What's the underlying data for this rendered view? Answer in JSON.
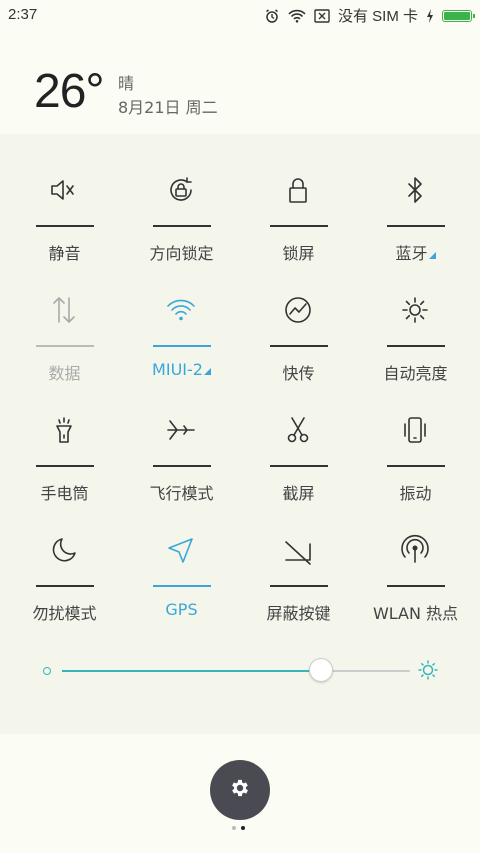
{
  "status_bar": {
    "time": "2:37",
    "carrier": "没有 SIM 卡",
    "icons": [
      "alarm-icon",
      "wifi-icon",
      "no-sim-icon",
      "charging-icon",
      "battery-icon"
    ],
    "battery_level": 1.0,
    "battery_color": "#3bb34a"
  },
  "weather": {
    "temperature": "26°",
    "condition": "晴",
    "date": "8月21日 周二"
  },
  "tiles": [
    {
      "label": "静音",
      "icon": "mute-icon",
      "state": "normal"
    },
    {
      "label": "方向锁定",
      "icon": "rotation-lock-icon",
      "state": "normal"
    },
    {
      "label": "锁屏",
      "icon": "lock-icon",
      "state": "normal"
    },
    {
      "label": "蓝牙",
      "icon": "bluetooth-icon",
      "state": "normal",
      "caret": true
    },
    {
      "label": "数据",
      "icon": "mobile-data-icon",
      "state": "dim"
    },
    {
      "label": "MIUI-2",
      "icon": "wifi-icon",
      "state": "active",
      "caret": true
    },
    {
      "label": "快传",
      "icon": "fast-transfer-icon",
      "state": "normal"
    },
    {
      "label": "自动亮度",
      "icon": "auto-brightness-icon",
      "state": "normal"
    },
    {
      "label": "手电筒",
      "icon": "flashlight-icon",
      "state": "normal"
    },
    {
      "label": "飞行模式",
      "icon": "airplane-icon",
      "state": "normal"
    },
    {
      "label": "截屏",
      "icon": "screenshot-icon",
      "state": "normal"
    },
    {
      "label": "振动",
      "icon": "vibrate-icon",
      "state": "normal"
    },
    {
      "label": "勿扰模式",
      "icon": "do-not-disturb-icon",
      "state": "normal"
    },
    {
      "label": "GPS",
      "icon": "gps-icon",
      "state": "active"
    },
    {
      "label": "屏蔽按键",
      "icon": "block-keys-icon",
      "state": "normal"
    },
    {
      "label": "WLAN 热点",
      "icon": "hotspot-icon",
      "state": "normal"
    }
  ],
  "brightness": {
    "level": 0.74,
    "accent": "#34b6b8"
  },
  "settings": {
    "icon": "gear-icon"
  },
  "pager": {
    "pages": 2,
    "current": 2
  },
  "colors": {
    "active": "#3aa7d8",
    "background": "#fbfcf4",
    "panel": "#f4f6ec"
  }
}
